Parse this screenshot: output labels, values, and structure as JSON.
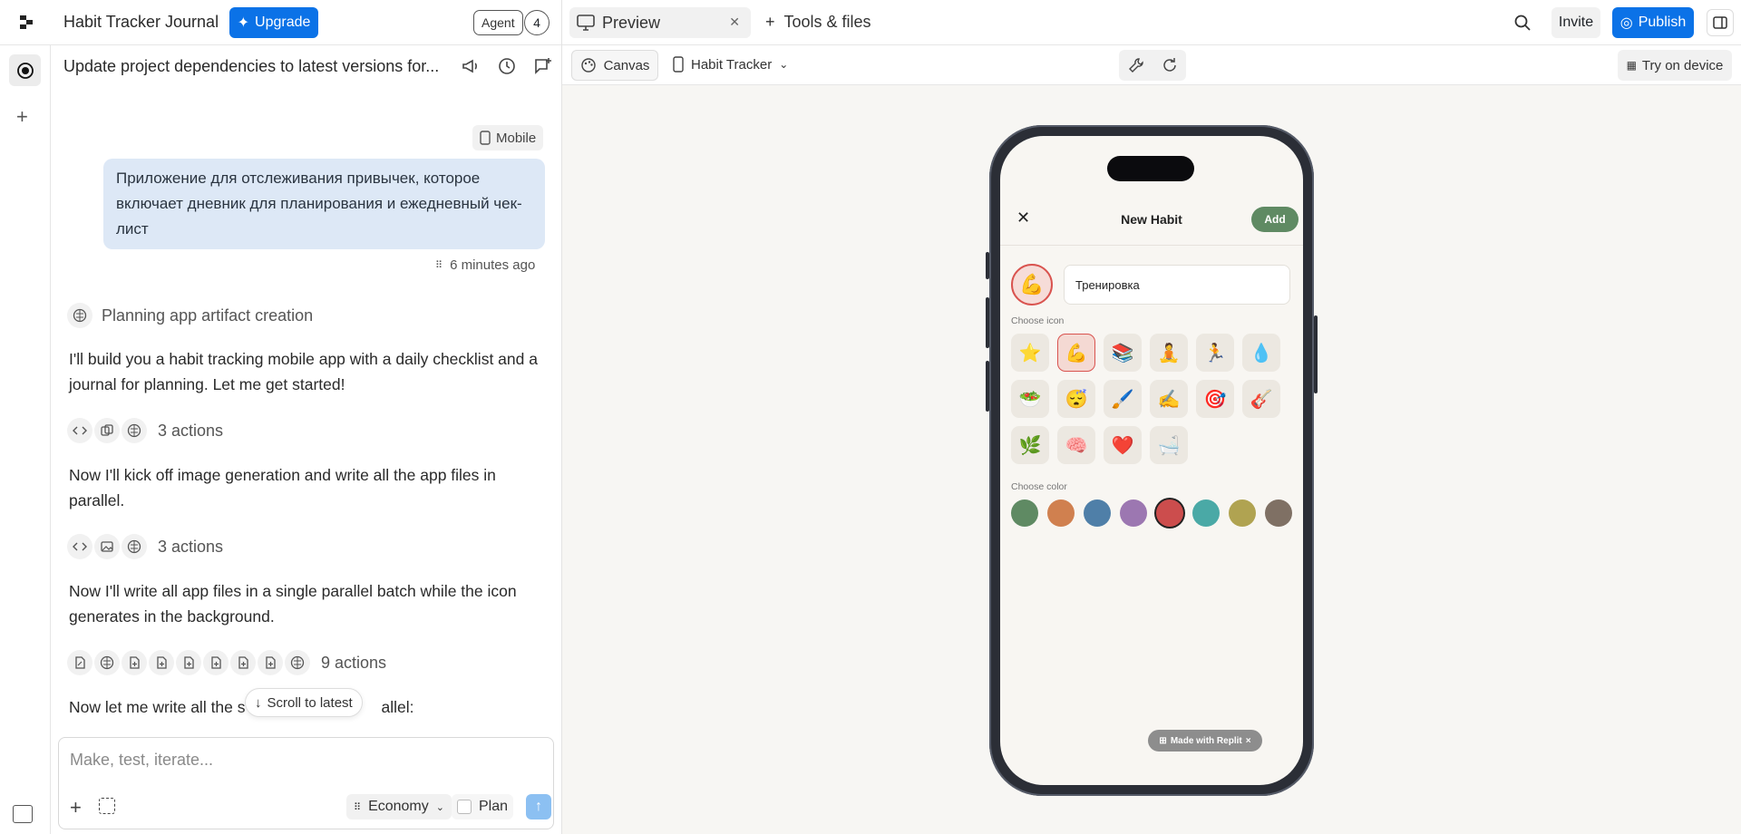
{
  "topbar": {
    "app_title": "Habit Tracker Journal",
    "upgrade_label": "Upgrade",
    "agent_label": "Agent",
    "agent_count": "4",
    "tabs": [
      {
        "label": "Preview"
      },
      {
        "label": "Tools & files"
      }
    ],
    "invite_label": "Invite",
    "publish_label": "Publish"
  },
  "chat": {
    "header": "Update project dependencies to latest versions for...",
    "device_tag": "Mobile",
    "user_message": "Приложение для отслеживания привычек, которое включает дневник для планирования и ежедневный чек-лист",
    "timestamp": "6 minutes ago",
    "planning_label": "Planning app artifact creation",
    "messages": [
      "I'll build you a habit tracking mobile app with a daily checklist and a journal for planning. Let me get started!",
      "Now I'll kick off image generation and write all the app files in parallel.",
      "Now I'll write all app files in a single parallel batch while the icon generates in the background.",
      "Now let me write all the s",
      "allel:"
    ],
    "action_groups": [
      {
        "label": "3 actions"
      },
      {
        "label": "3 actions"
      },
      {
        "label": "9 actions"
      }
    ],
    "scroll_latest": "Scroll to latest",
    "composer": {
      "placeholder": "Make, test, iterate...",
      "mode": "Economy",
      "plan_label": "Plan"
    }
  },
  "preview": {
    "canvas_label": "Canvas",
    "device_name": "Habit Tracker",
    "try_device": "Try on device",
    "app": {
      "title": "New Habit",
      "add_label": "Add",
      "habit_name": "Тренировка",
      "choose_icon": "Choose icon",
      "choose_color": "Choose color",
      "icons": [
        "⭐",
        "💪",
        "📚",
        "🧘",
        "🏃",
        "💧",
        "🥗",
        "😴",
        "🖌️",
        "✍️",
        "🎯",
        "🎸",
        "🌿",
        "🧠",
        "❤️",
        "🛁"
      ],
      "selected_icon": "💪",
      "colors": [
        "#5f8a63",
        "#d0804f",
        "#4f7fa8",
        "#9c77b1",
        "#cc4d4d",
        "#4aa9a6",
        "#b0a351",
        "#7f7064"
      ],
      "selected_color_index": 4,
      "made_with": "Made with Replit"
    }
  },
  "colors": {
    "accent": "#0b72e7",
    "user_bubble": "#dde8f6",
    "app_add": "#5f8a63"
  }
}
